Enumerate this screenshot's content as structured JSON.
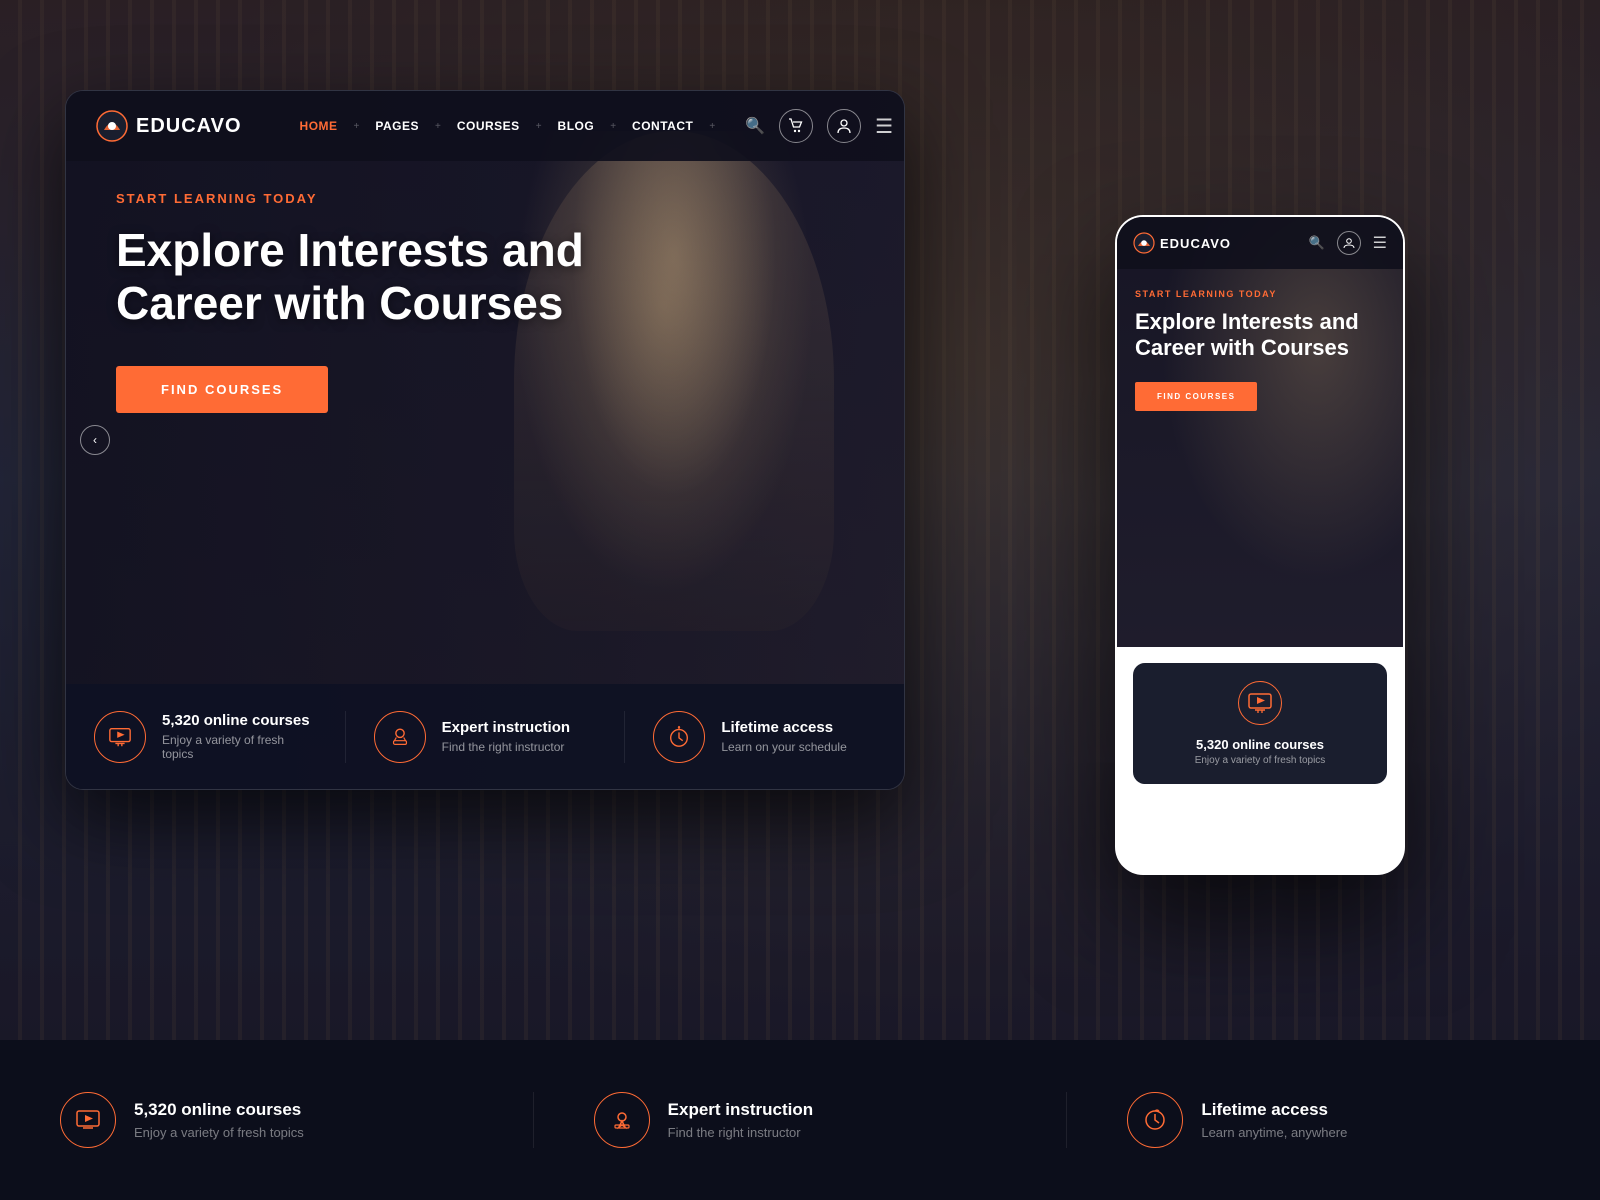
{
  "site": {
    "name": "EDUCAVO"
  },
  "desktop": {
    "nav": {
      "home": "HOME",
      "pages": "PAGES",
      "courses": "COURSES",
      "blog": "BLOG",
      "contact": "CONTACT"
    },
    "hero": {
      "subtitle": "START LEARNING TODAY",
      "title_line1": "Explore Interests and",
      "title_line2": "Career with Courses",
      "cta": "FIND COURSES"
    },
    "stats": [
      {
        "title": "5,320 online courses",
        "desc": "Enjoy a variety of fresh topics",
        "icon": "play"
      },
      {
        "title": "Expert instruction",
        "desc": "Find the right instructor",
        "icon": "gear"
      },
      {
        "title": "Lifetime access",
        "desc": "Learn on your schedule",
        "icon": "clock"
      }
    ]
  },
  "mobile": {
    "hero": {
      "subtitle": "START LEARNING TODAY",
      "title_line1": "Explore Interests and",
      "title_line2": "Career with Courses",
      "cta": "FIND COURSES"
    },
    "stat": {
      "title": "5,320 online courses",
      "desc": "Enjoy a variety of fresh topics"
    }
  },
  "bottom_stats": [
    {
      "title": "5,320 online courses",
      "desc": "Enjoy a variety of fresh topics",
      "icon": "play"
    },
    {
      "title": "Expert instruction",
      "desc": "Find the right instructor",
      "icon": "gear"
    },
    {
      "title": "Lifetime access",
      "desc": "Learn anytime, anywhere",
      "icon": "clock"
    }
  ]
}
